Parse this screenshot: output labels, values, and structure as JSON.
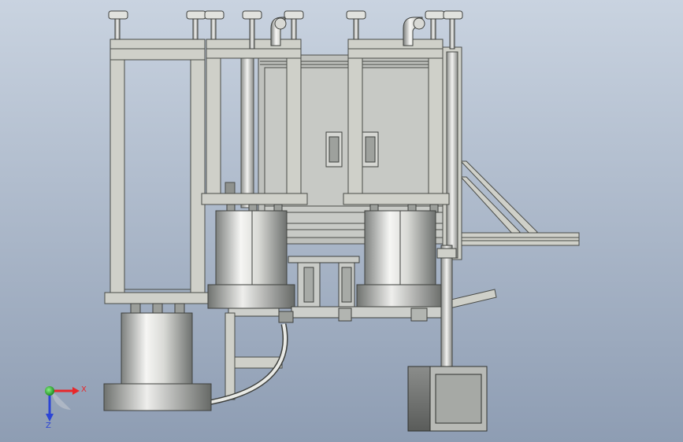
{
  "viewport": {
    "background_top": "#c9d3e0",
    "background_bottom": "#8d9cb2"
  },
  "colors": {
    "frame_fill": "#cfd0c9",
    "frame_stroke": "#4a4c48",
    "metal_light": "#f4f4f2",
    "metal_dark": "#7c7e7c",
    "panel_fill": "#b9bcb8",
    "motor_fill": "#6c6e6c",
    "axis_x": "#e8272a",
    "axis_y": "#2ec22e",
    "axis_z": "#2b44d6"
  },
  "triad": {
    "x_label": "X",
    "z_label": "Z",
    "icon": "coordinate-triad-icon"
  }
}
